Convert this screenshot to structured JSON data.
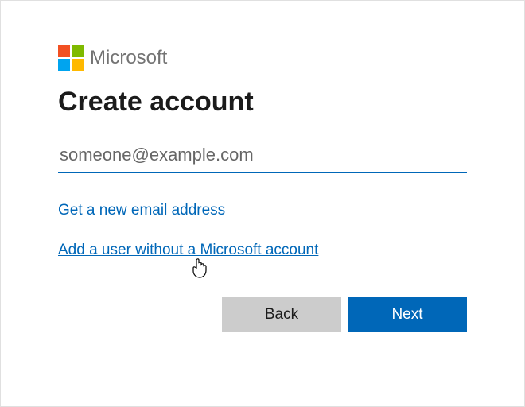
{
  "brand": "Microsoft",
  "heading": "Create account",
  "emailInput": {
    "value": "",
    "placeholder": "someone@example.com"
  },
  "links": {
    "newEmail": "Get a new email address",
    "noAccount": "Add a user without a Microsoft account"
  },
  "buttons": {
    "back": "Back",
    "next": "Next"
  },
  "icons": {
    "logo": "microsoft-logo",
    "cursor": "pointer-cursor"
  },
  "colors": {
    "accent": "#0067b8",
    "buttonSecondary": "#cccccc",
    "logo": {
      "topLeft": "#f25022",
      "topRight": "#7fba00",
      "bottomLeft": "#00a4ef",
      "bottomRight": "#ffb900"
    }
  }
}
